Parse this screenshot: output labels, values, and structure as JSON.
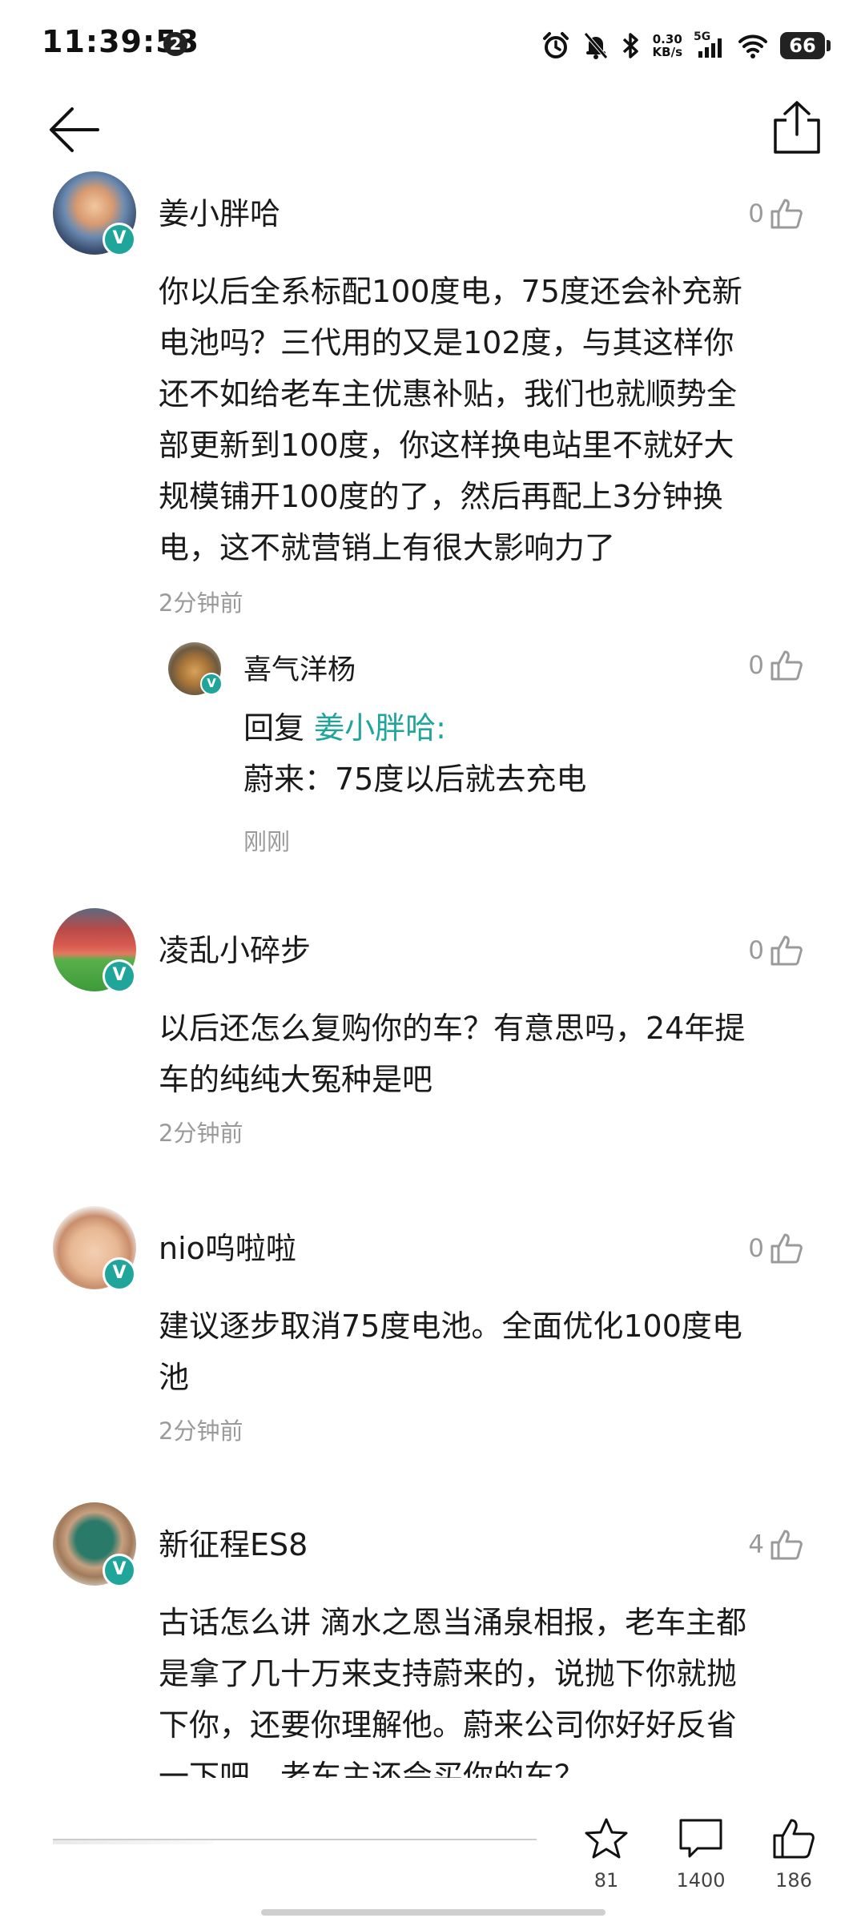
{
  "status_bar": {
    "time": "11:39:53",
    "notification_count": "2",
    "net_speed_value": "0.30",
    "net_speed_unit": "KB/s",
    "network_type": "5G",
    "battery_level": "66"
  },
  "icons": {
    "back": "arrow-left-icon",
    "share": "share-icon",
    "like": "thumbs-up-icon",
    "favorite": "star-icon",
    "comment": "comment-bubble-icon"
  },
  "colors": {
    "accent": "#1fa59a",
    "meta_text": "#9a9a9a",
    "body_text": "#1a1a1a"
  },
  "comments": [
    {
      "username": "姜小胖哈",
      "likes": "0",
      "lines": [
        "你以后全系标配100度电，75度还会补充新",
        "电池吗？三代用的又是102度，与其这样你",
        "还不如给老车主优惠补贴，我们也就顺势全",
        "部更新到100度，你这样换电站里不就好大",
        "规模铺开100度的了，然后再配上3分钟换",
        "电，这不就营销上有很大影响力了"
      ],
      "time": "2分钟前",
      "replies": [
        {
          "username": "喜气洋杨",
          "likes": "0",
          "reply_prefix": "回复 ",
          "reply_to": "姜小胖哈:",
          "text": "蔚来：75度以后就去充电",
          "time": "刚刚"
        }
      ]
    },
    {
      "username": "凌乱小碎步",
      "likes": "0",
      "lines": [
        "以后还怎么复购你的车？有意思吗，24年提",
        "车的纯纯大冤种是吧"
      ],
      "time": "2分钟前"
    },
    {
      "username": "nio呜啦啦",
      "likes": "0",
      "lines": [
        "建议逐步取消75度电池。全面优化100度电",
        "池"
      ],
      "time": "2分钟前"
    },
    {
      "username": "新征程ES8",
      "likes": "4",
      "lines": [
        "古话怎么讲 滴水之恩当涌泉相报，老车主都",
        "是拿了几十万来支持蔚来的，说抛下你就抛",
        "下你，还要你理解他。蔚来公司你好好反省",
        "一下吧。老车主还会买你的车？"
      ]
    }
  ],
  "bottom_bar": {
    "favorites_count": "81",
    "comments_count": "1400",
    "likes_count": "186"
  }
}
